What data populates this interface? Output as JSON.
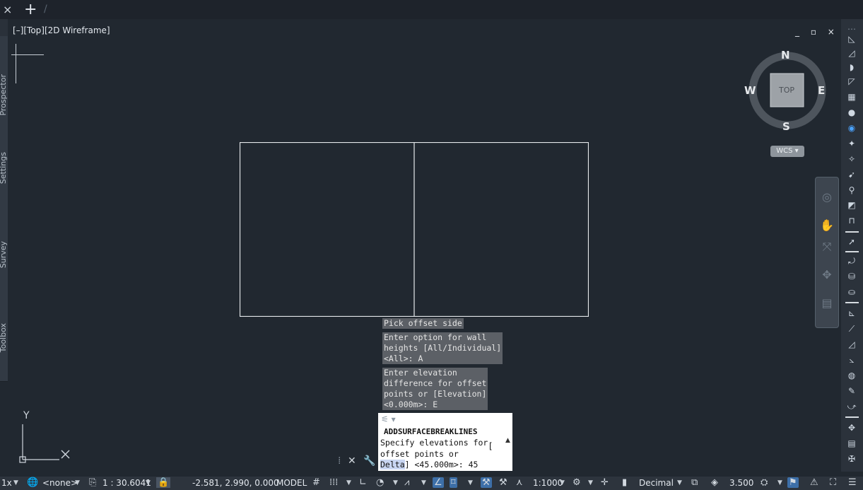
{
  "tabs": {
    "close": "×",
    "add": "+",
    "sep": "/"
  },
  "left_palettes": [
    "Prospector",
    "Settings",
    "Survey",
    "Toolbox"
  ],
  "viewport": {
    "label": "[–][Top][2D Wireframe]",
    "controls": "_ ▫ ×"
  },
  "viewcube": {
    "north": "N",
    "south": "S",
    "east": "E",
    "west": "W",
    "face": "TOP",
    "wcs": "WCS ▾"
  },
  "history": [
    {
      "text": "Pick offset side"
    },
    {
      "text": "Enter option for wall\nheights [All/Individual]\n<All>: A"
    },
    {
      "text": "Enter elevation\ndifference for offset\npoints or [Elevation]\n<0.000m>: E"
    }
  ],
  "command_line": {
    "command": "ADDSURFACEBREAKLINES",
    "prompt_line1": "Specify elevations for",
    "prompt_line2": "offset points or",
    "prompt_keyword": "Delta",
    "prompt_tail": "] <45.000m>: 45",
    "bracket": "["
  },
  "ucs": {
    "y": "Y"
  },
  "status": {
    "zoom": "1x",
    "coord_system": "<none>",
    "scale_display": "1 : 30.6041",
    "coordinates": "-2.581, 2.990, 0.000",
    "space": "MODEL",
    "annotation_scale": "1:1000",
    "units": "Decimal",
    "lineweight": "3.500"
  },
  "colors": {
    "background": "#212830",
    "statusbar": "#2d343d",
    "active_button": "#3d6fa8",
    "history_box": "#5c6066"
  }
}
